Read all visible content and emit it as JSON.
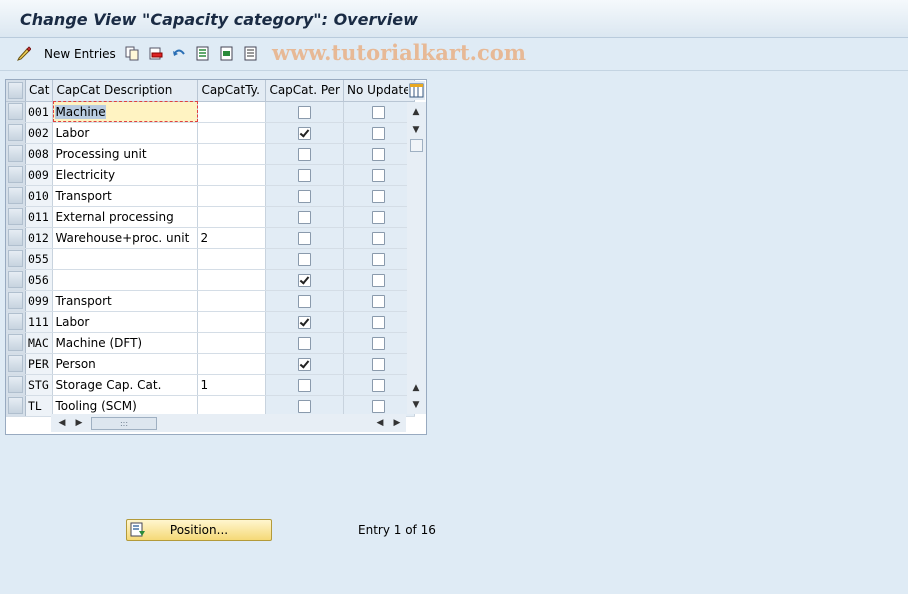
{
  "window": {
    "title": "Change View \"Capacity category\": Overview"
  },
  "toolbar": {
    "new_entries_label": "New Entries",
    "watermark": "www.tutorialkart.com"
  },
  "table": {
    "columns": [
      "Cat",
      "CapCat Description",
      "CapCatTy.",
      "CapCat. Per",
      "No Update"
    ],
    "rows": [
      {
        "cat": "001",
        "desc": "Machine",
        "type": "",
        "per": false,
        "noupd": false
      },
      {
        "cat": "002",
        "desc": "Labor",
        "type": "",
        "per": true,
        "noupd": false
      },
      {
        "cat": "008",
        "desc": "Processing unit",
        "type": "",
        "per": false,
        "noupd": false
      },
      {
        "cat": "009",
        "desc": "Electricity",
        "type": "",
        "per": false,
        "noupd": false
      },
      {
        "cat": "010",
        "desc": "Transport",
        "type": "",
        "per": false,
        "noupd": false
      },
      {
        "cat": "011",
        "desc": "External processing",
        "type": "",
        "per": false,
        "noupd": false
      },
      {
        "cat": "012",
        "desc": "Warehouse+proc. unit",
        "type": "2",
        "per": false,
        "noupd": false
      },
      {
        "cat": "055",
        "desc": "",
        "type": "",
        "per": false,
        "noupd": false
      },
      {
        "cat": "056",
        "desc": "",
        "type": "",
        "per": true,
        "noupd": false
      },
      {
        "cat": "099",
        "desc": "Transport",
        "type": "",
        "per": false,
        "noupd": false
      },
      {
        "cat": "111",
        "desc": "Labor",
        "type": "",
        "per": true,
        "noupd": false
      },
      {
        "cat": "MAC",
        "desc": "Machine (DFT)",
        "type": "",
        "per": false,
        "noupd": false
      },
      {
        "cat": "PER",
        "desc": "Person",
        "type": "",
        "per": true,
        "noupd": false
      },
      {
        "cat": "STG",
        "desc": "Storage Cap. Cat.",
        "type": "1",
        "per": false,
        "noupd": false
      },
      {
        "cat": "TL",
        "desc": "Tooling (SCM)",
        "type": "",
        "per": false,
        "noupd": false
      }
    ]
  },
  "footer": {
    "position_label": "Position...",
    "entry_info": "Entry 1 of 16"
  }
}
